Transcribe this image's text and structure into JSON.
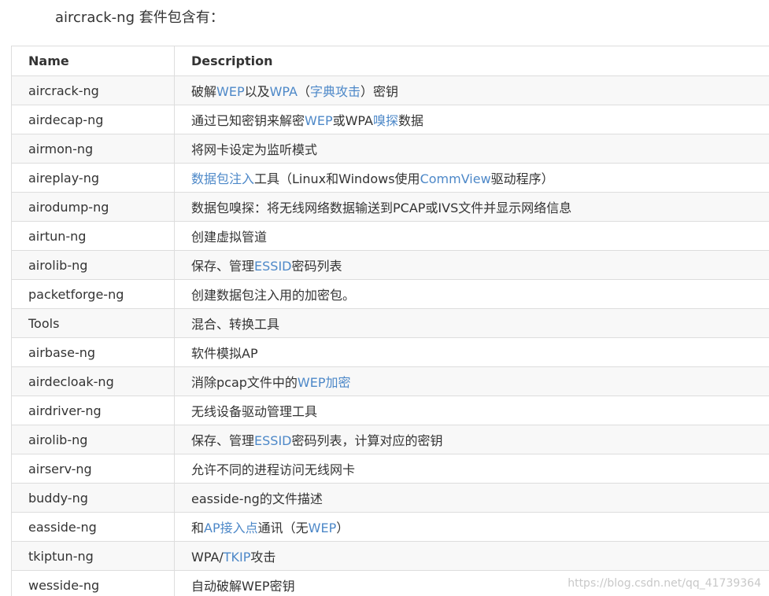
{
  "intro": "aircrack-ng 套件包含有：",
  "table": {
    "headers": {
      "name": "Name",
      "description": "Description"
    },
    "rows": [
      {
        "name": "aircrack-ng",
        "desc": [
          {
            "t": "破解"
          },
          {
            "t": "WEP",
            "link": true
          },
          {
            "t": "以及"
          },
          {
            "t": "WPA",
            "link": true
          },
          {
            "t": "（"
          },
          {
            "t": "字典攻击",
            "link": true
          },
          {
            "t": "）密钥"
          }
        ]
      },
      {
        "name": "airdecap-ng",
        "desc": [
          {
            "t": "通过已知密钥来解密"
          },
          {
            "t": "WEP",
            "link": true
          },
          {
            "t": "或WPA"
          },
          {
            "t": "嗅探",
            "link": true
          },
          {
            "t": "数据"
          }
        ]
      },
      {
        "name": "airmon-ng",
        "desc": [
          {
            "t": "将网卡设定为监听模式"
          }
        ]
      },
      {
        "name": "aireplay-ng",
        "desc": [
          {
            "t": "数据包注入",
            "link": true
          },
          {
            "t": "工具（Linux和Windows使用"
          },
          {
            "t": "CommView",
            "link": true
          },
          {
            "t": "驱动程序）"
          }
        ]
      },
      {
        "name": "airodump-ng",
        "desc": [
          {
            "t": "数据包嗅探：将无线网络数据输送到PCAP或IVS文件并显示网络信息"
          }
        ]
      },
      {
        "name": "airtun-ng",
        "desc": [
          {
            "t": "创建虚拟管道"
          }
        ]
      },
      {
        "name": "airolib-ng",
        "desc": [
          {
            "t": "保存、管理"
          },
          {
            "t": "ESSID",
            "link": true
          },
          {
            "t": "密码列表"
          }
        ]
      },
      {
        "name": "packetforge-ng",
        "desc": [
          {
            "t": "创建数据包注入用的加密包。"
          }
        ]
      },
      {
        "name": "Tools",
        "desc": [
          {
            "t": "混合、转换工具"
          }
        ]
      },
      {
        "name": "airbase-ng",
        "desc": [
          {
            "t": "软件模拟AP"
          }
        ]
      },
      {
        "name": "airdecloak-ng",
        "desc": [
          {
            "t": "消除pcap文件中的"
          },
          {
            "t": "WEP加密",
            "link": true
          }
        ]
      },
      {
        "name": "airdriver-ng",
        "desc": [
          {
            "t": "无线设备驱动管理工具"
          }
        ]
      },
      {
        "name": "airolib-ng",
        "desc": [
          {
            "t": "保存、管理"
          },
          {
            "t": "ESSID",
            "link": true
          },
          {
            "t": "密码列表，计算对应的密钥"
          }
        ]
      },
      {
        "name": "airserv-ng",
        "desc": [
          {
            "t": "允许不同的进程访问无线网卡"
          }
        ]
      },
      {
        "name": "buddy-ng",
        "desc": [
          {
            "t": "easside-ng的文件描述"
          }
        ]
      },
      {
        "name": "easside-ng",
        "desc": [
          {
            "t": "和"
          },
          {
            "t": "AP接入点",
            "link": true
          },
          {
            "t": "通讯（无"
          },
          {
            "t": "WEP",
            "link": true
          },
          {
            "t": "）"
          }
        ]
      },
      {
        "name": "tkiptun-ng",
        "desc": [
          {
            "t": "WPA/"
          },
          {
            "t": "TKIP",
            "link": true
          },
          {
            "t": "攻击"
          }
        ]
      },
      {
        "name": "wesside-ng",
        "desc": [
          {
            "t": "自动破解WEP密钥"
          }
        ]
      }
    ]
  },
  "watermark": "https://blog.csdn.net/qq_41739364",
  "colors": {
    "link": "#4d88c8",
    "text": "#333333",
    "border": "#dddddd",
    "stripe": "#f8f8f8"
  }
}
